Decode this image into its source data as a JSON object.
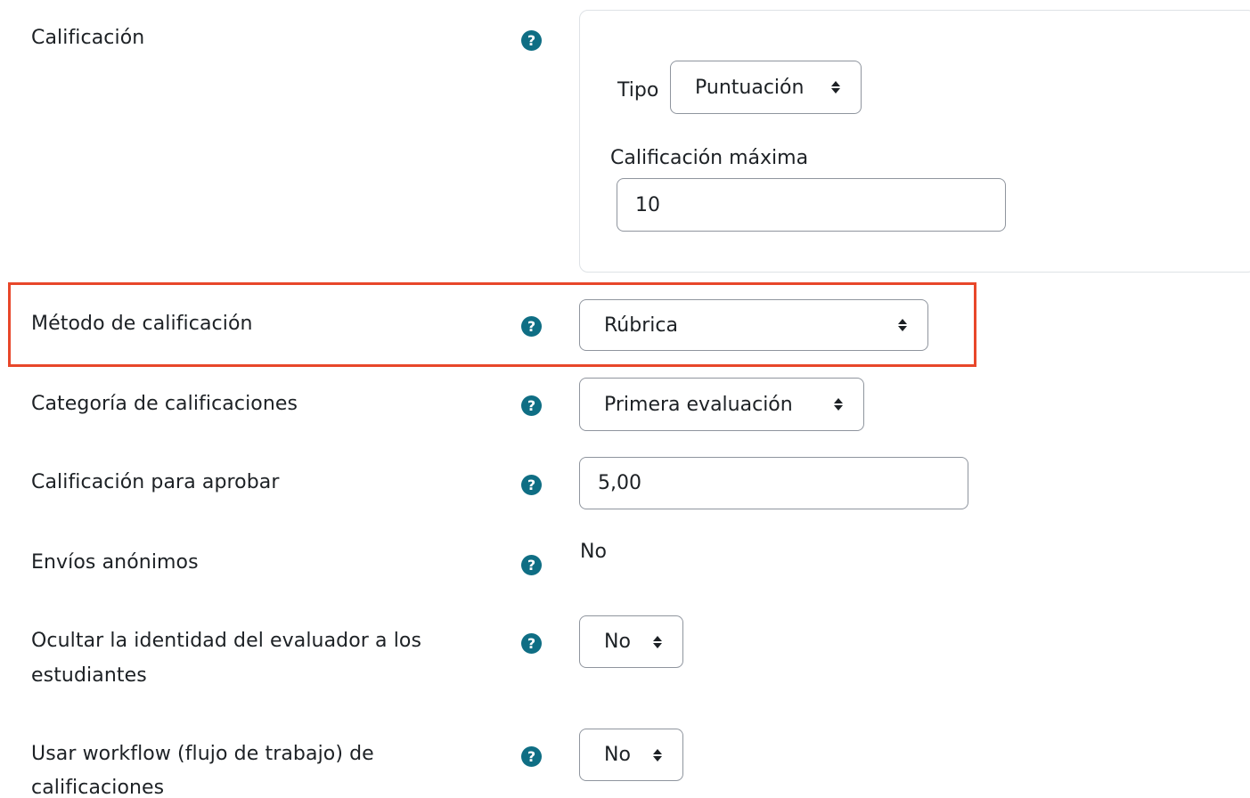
{
  "grade": {
    "label": "Calificación",
    "type_label": "Tipo",
    "type_value": "Puntuación",
    "max_label": "Calificación máxima",
    "max_value": "10"
  },
  "grading_method": {
    "label": "Método de calificación",
    "value": "Rúbrica",
    "highlight_color": "#e8472a"
  },
  "grade_category": {
    "label": "Categoría de calificaciones",
    "value": "Primera evaluación"
  },
  "grade_to_pass": {
    "label": "Calificación para aprobar",
    "value": "5,00"
  },
  "anonymous": {
    "label": "Envíos anónimos",
    "value": "No"
  },
  "hide_grader": {
    "label_line1": "Ocultar la identidad del evaluador a los",
    "label_line2": "estudiantes",
    "value": "No"
  },
  "workflow": {
    "label_line1": "Usar workflow (flujo de trabajo) de",
    "label_line2": "calificaciones",
    "value": "No"
  },
  "icons": {
    "help": "question-circle-icon",
    "caret": "sort-caret-icon"
  },
  "help_glyph": "?",
  "colors": {
    "help_icon": "#0f6e84",
    "border": "#8f959e",
    "text": "#1d2125"
  }
}
